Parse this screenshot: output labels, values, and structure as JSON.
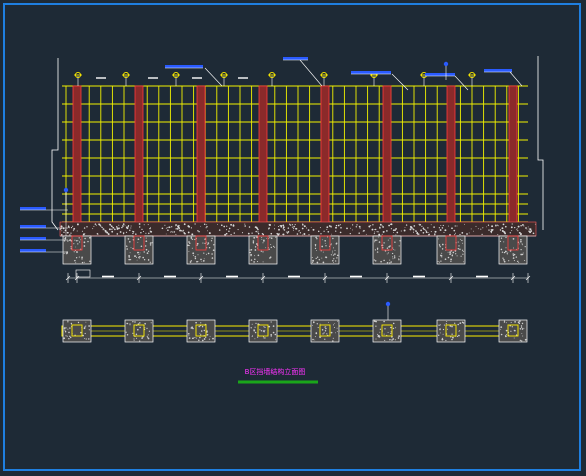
{
  "drawing": {
    "caption": "B区挡墙结构立面图",
    "colors": {
      "background": "#1e2a36",
      "frame": "#1f7fe0",
      "grid": "#f2f200",
      "column": "#8b2a2a",
      "column_edge": "#ff3b3b",
      "outline": "#ffffff",
      "leader": "#ffffff",
      "callout": "#2a5bff",
      "caption": "#ff33ff",
      "caption_underline": "#1aa51a",
      "footing": "#cfcfcf",
      "marker": "#ffee00"
    },
    "icons": [
      "anchor-marker-icon",
      "elevation-marker-icon",
      "footing-plan-icon"
    ]
  }
}
